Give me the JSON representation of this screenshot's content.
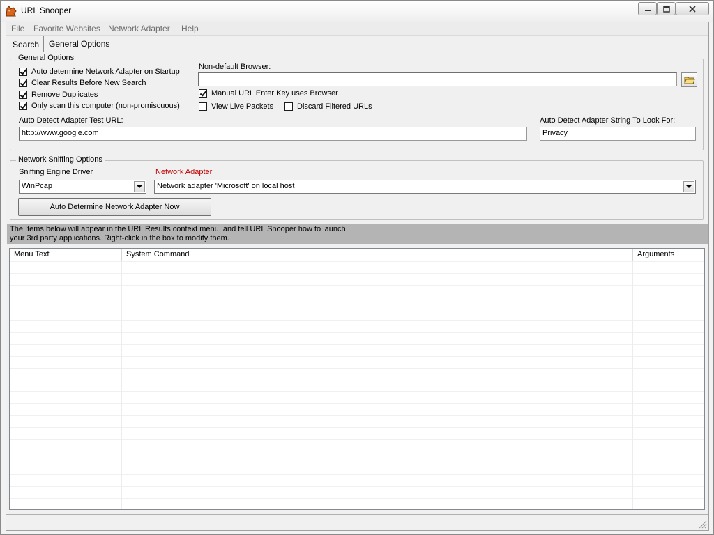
{
  "window": {
    "title": "URL Snooper",
    "icon": "fox-app-icon"
  },
  "menu": [
    "File",
    "Favorite Websites",
    "Network Adapter",
    "Help"
  ],
  "tabs": [
    {
      "label": "Search",
      "active": false
    },
    {
      "label": "General Options",
      "active": true
    }
  ],
  "general_options": {
    "title": "General Options",
    "checkboxes": [
      {
        "label": "Auto determine Network Adapter on Startup",
        "checked": true
      },
      {
        "label": "Clear Results Before New Search",
        "checked": true
      },
      {
        "label": "Remove Duplicates",
        "checked": true
      },
      {
        "label": "Only scan this computer (non-promiscuous)",
        "checked": true
      }
    ],
    "browser_label": "Non-default Browser:",
    "browser_value": "",
    "manual_url_label": "Manual URL Enter Key uses Browser",
    "manual_url_checked": true,
    "live_packets_label": "View Live Packets",
    "live_packets_checked": false,
    "discard_label": "Discard Filtered URLs",
    "discard_checked": false,
    "test_url_label": "Auto Detect Adapter Test URL:",
    "test_url_value": "http://www.google.com",
    "lookfor_label": "Auto Detect Adapter String To Look For:",
    "lookfor_value": "Privacy"
  },
  "sniffing": {
    "title": "Network Sniffing Options",
    "engine_label": "Sniffing Engine Driver",
    "engine_value": "WinPcap",
    "adapter_label": "Network Adapter",
    "adapter_label_color": "#c00000",
    "adapter_value": "Network adapter 'Microsoft' on local host",
    "auto_button": "Auto Determine Network Adapter Now"
  },
  "info_banner": {
    "line1": "The Items below will appear in the URL Results context menu, and tell URL Snooper how to launch",
    "line2": "your 3rd party applications.  Right-click in the box to modify them."
  },
  "commands_table": {
    "columns": [
      "Menu Text",
      "System Command",
      "Arguments"
    ],
    "rows": []
  }
}
